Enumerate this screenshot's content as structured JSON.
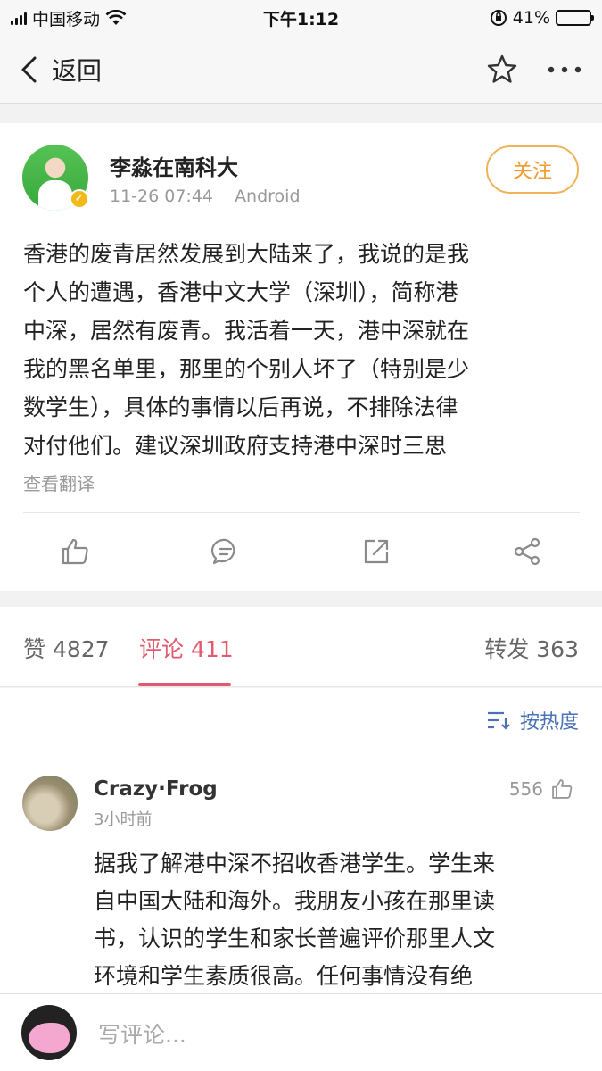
{
  "status_bar": {
    "carrier": "中国移动",
    "time": "下午1:12",
    "battery_percent": "41%",
    "battery_level": 0.41,
    "icons": [
      "signal-icon",
      "wifi-icon",
      "orientation-lock-icon",
      "battery-icon"
    ]
  },
  "nav": {
    "back_label": "返回",
    "icons": [
      "back-arrow-icon",
      "star-icon",
      "more-icon"
    ]
  },
  "post": {
    "author": "李淼在南科大",
    "time": "11-26 07:44",
    "source": "Android",
    "follow_label": "关注",
    "verified_badge": "✓",
    "content_lines": [
      "香港的废青居然发展到大陆来了，我说的是我",
      "个人的遭遇，香港中文大学（深圳），简称港",
      "中深，居然有废青。我活着一天，港中深就在",
      "我的黑名单里，那里的个别人坏了（特别是少",
      "数学生），具体的事情以后再说，不排除法律",
      "对付他们。建议深圳政府支持港中深时三思"
    ],
    "translate_label": "查看翻译",
    "action_icons": [
      "like-icon",
      "comment-icon",
      "repost-icon",
      "share-icon"
    ]
  },
  "tabs": {
    "likes": "赞 4827",
    "comments": "评论 411",
    "reposts": "转发 363",
    "active": "comments"
  },
  "sort": {
    "label": "按热度",
    "icon": "sort-icon"
  },
  "comment": {
    "name": "Crazy·Frog",
    "time": "3小时前",
    "likes": "556",
    "text_lines": [
      "据我了解港中深不招收香港学生。学生来",
      "自中国大陆和海外。我朋友小孩在那里读",
      "书，认识的学生和家长普遍评价那里人文",
      "环境和学生素质很高。任何事情没有绝"
    ]
  },
  "reply": {
    "placeholder": "写评论..."
  },
  "colors": {
    "accent_pink": "#e25a6f",
    "follow_orange": "#f19b2c",
    "link_blue": "#4a72b5",
    "verified_gold": "#f3b81a"
  }
}
